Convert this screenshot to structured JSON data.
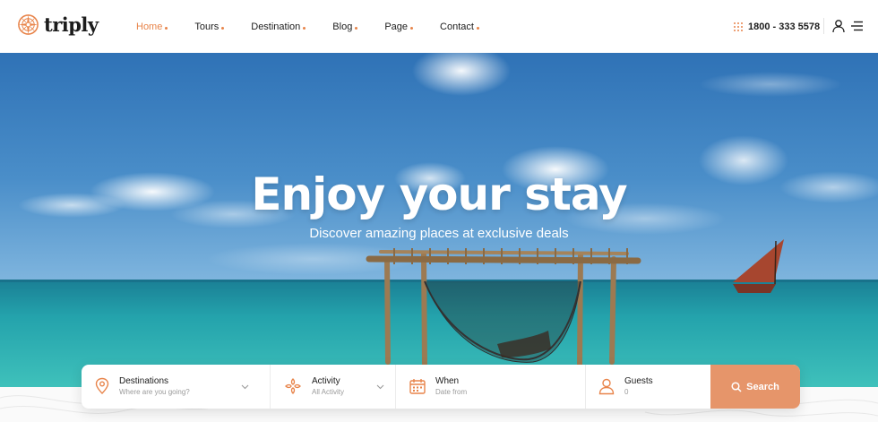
{
  "brand": {
    "name": "triply",
    "logo_icon": "compass-icon",
    "accent": "#e8844a"
  },
  "nav": {
    "items": [
      {
        "label": "Home",
        "active": true
      },
      {
        "label": "Tours",
        "active": false
      },
      {
        "label": "Destination",
        "active": false
      },
      {
        "label": "Blog",
        "active": false
      },
      {
        "label": "Page",
        "active": false
      },
      {
        "label": "Contact",
        "active": false
      }
    ]
  },
  "header": {
    "phone": "1800 - 333 5578",
    "phone_icon": "dial-pad-icon",
    "user_icon": "user-icon",
    "menu_icon": "menu-icon"
  },
  "hero": {
    "title": "Enjoy your stay",
    "subtitle": "Discover amazing places at exclusive deals"
  },
  "search": {
    "destination": {
      "label": "Destinations",
      "value": "Where are you going?",
      "icon": "map-pin-icon"
    },
    "activity": {
      "label": "Activity",
      "value": "All Activity",
      "icon": "activity-icon"
    },
    "when": {
      "label": "When",
      "value": "Date from",
      "icon": "calendar-icon"
    },
    "guests": {
      "label": "Guests",
      "value": "0",
      "icon": "user-icon"
    },
    "button_label": "Search",
    "button_color": "#e6956a"
  }
}
